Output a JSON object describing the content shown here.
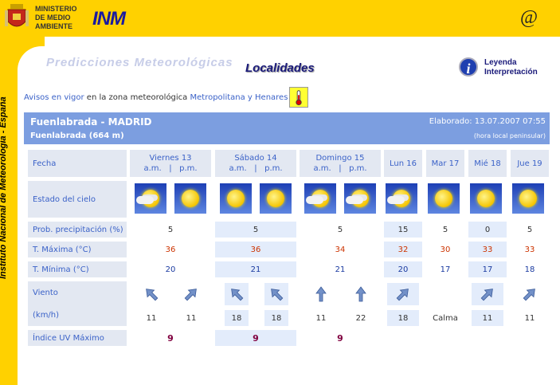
{
  "header": {
    "ministry_line1": "MINISTERIO",
    "ministry_line2": "DE MEDIO",
    "ministry_line3": "AMBIENTE",
    "logo_text": "INM",
    "at_symbol": "@"
  },
  "sidebar": {
    "text": "Instituto Nacional de Meteorología - España"
  },
  "page": {
    "ghost_title": "Predicciones Meteorológicas",
    "title": "Localidades",
    "legend_line1": "Leyenda",
    "legend_line2": "Interpretación"
  },
  "avisos": {
    "link1": "Avisos en vigor",
    "text": " en la zona meteorológica ",
    "link2": "Metropolitana y Henares"
  },
  "location": {
    "name": "Fuenlabrada - MADRID",
    "sub": "Fuenlabrada (664 m)",
    "elaborado": "Elaborado: 13.07.2007 07:55",
    "hora": "(hora local peninsular)"
  },
  "row_labels": {
    "fecha": "Fecha",
    "estado": "Estado del cielo",
    "precip": "Prob. precipitación (%)",
    "tmax": "T. Máxima (°C)",
    "tmin": "T. Mínima (°C)",
    "viento": "Viento",
    "kmh": "(km/h)",
    "uv": "Índice UV Máximo"
  },
  "days": [
    {
      "label": "Viernes 13",
      "ampm": "a.m.   |   p.m."
    },
    {
      "label": "Sábado 14",
      "ampm": "a.m.   |   p.m."
    },
    {
      "label": "Domingo 15",
      "ampm": "a.m.   |   p.m."
    },
    {
      "label": "Lun 16"
    },
    {
      "label": "Mar 17"
    },
    {
      "label": "Mié 18"
    },
    {
      "label": "Jue 19"
    }
  ],
  "sky_icons": [
    "sun-cloud-icon",
    "sun-icon",
    "sun-icon",
    "sun-icon",
    "sun-cloud-icon",
    "sun-cloud-icon",
    "sun-cloud-icon",
    "sun-icon",
    "sun-icon",
    "sun-icon"
  ],
  "precip": [
    "5",
    "5",
    "5",
    "15",
    "5",
    "0",
    "5"
  ],
  "tmax": [
    "36",
    "36",
    "34",
    "32",
    "30",
    "33",
    "33"
  ],
  "tmin": [
    "20",
    "21",
    "21",
    "20",
    "17",
    "17",
    "18"
  ],
  "wind_dirs": [
    "nw",
    "ne",
    "nw",
    "nw",
    "n",
    "n",
    "ne",
    "",
    "ne",
    "ne"
  ],
  "wind_speed": [
    "11",
    "11",
    "18",
    "18",
    "11",
    "22",
    "18",
    "Calma",
    "11",
    "11"
  ],
  "uv": [
    "9",
    "9",
    "9"
  ]
}
